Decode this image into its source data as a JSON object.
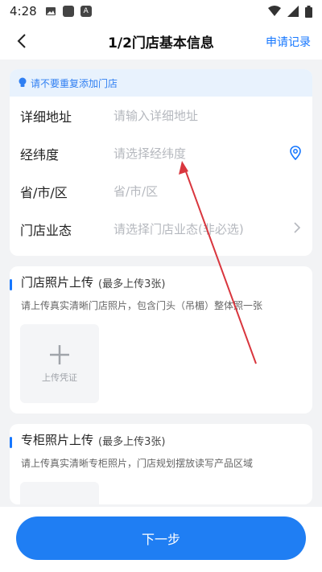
{
  "status_bar": {
    "time": "4:28",
    "a_icon_text": "A"
  },
  "nav": {
    "title": "1/2门店基本信息",
    "right_link": "申请记录"
  },
  "notice": {
    "text": "请不要重复添加门店"
  },
  "form": {
    "rows": [
      {
        "label": "详细地址",
        "placeholder": "请输入详细地址"
      },
      {
        "label": "经纬度",
        "placeholder": "请选择经纬度"
      },
      {
        "label": "省/市/区",
        "placeholder": "省/市/区"
      },
      {
        "label": "门店业态",
        "placeholder": "请选择门店业态(非必选)"
      }
    ]
  },
  "store_photo": {
    "title": "门店照片上传",
    "limit": "(最多上传3张)",
    "desc": "请上传真实清晰门店照片，包含门头（吊楣）整体照一张",
    "upload_label": "上传凭证"
  },
  "counter_photo": {
    "title": "专柜照片上传",
    "limit": "(最多上传3张)",
    "desc": "请上传真实清晰专柜照片，门店规划摆放读写产品区域"
  },
  "footer": {
    "next_label": "下一步"
  },
  "colors": {
    "accent": "#1677ff",
    "annotation_arrow": "#d9363e"
  }
}
